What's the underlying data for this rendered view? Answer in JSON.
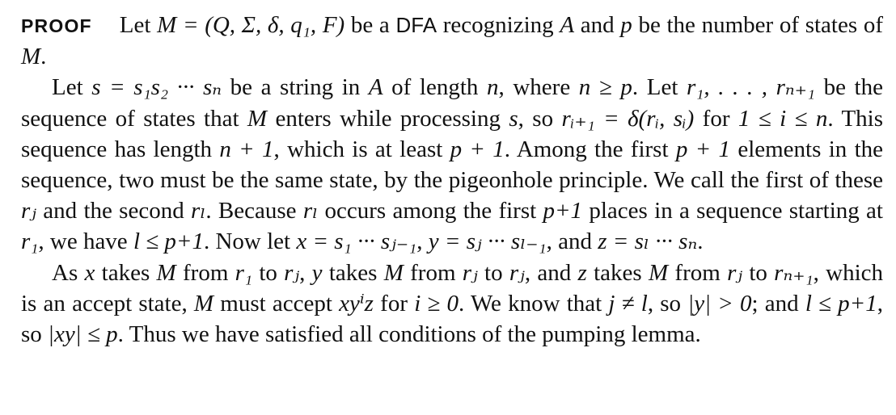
{
  "proof": {
    "label": "PROOF",
    "p1": {
      "t1": "Let ",
      "m1": "M = (Q, Σ, δ, q₁, F)",
      "t2": " be a ",
      "dfa": "DFA",
      "t3": " recognizing ",
      "m2": "A",
      "t4": " and ",
      "m3": "p",
      "t5": " be the number of states of ",
      "m4": "M",
      "t6": "."
    },
    "p2": {
      "t1": "Let ",
      "m1": "s = s₁s₂ ··· sₙ",
      "t2": " be a string in ",
      "m2": "A",
      "t3": " of length ",
      "m3": "n",
      "t4": ", where ",
      "m4": "n ≥ p",
      "t5": ". Let ",
      "m5": "r₁, . . . , rₙ₊₁",
      "t6": " be the sequence of states that ",
      "m6": "M",
      "t7": " enters while processing ",
      "m7": "s",
      "t8": ", so ",
      "m8": "rᵢ₊₁ = δ(rᵢ, sᵢ)",
      "t9": " for ",
      "m9": "1 ≤ i ≤ n",
      "t10": ". This sequence has length ",
      "m10": "n + 1",
      "t11": ", which is at least ",
      "m11": "p + 1",
      "t12": ". Among the first ",
      "m12": "p + 1",
      "t13": " elements in the sequence, two must be the same state, by the pigeonhole principle. We call the first of these ",
      "m13": "rⱼ",
      "t14": " and the second ",
      "m14": "rₗ",
      "t15": ". Because ",
      "m15": "rₗ",
      "t16": " occurs among the first ",
      "m16": "p+1",
      "t17": " places in a sequence starting at ",
      "m17": "r₁",
      "t18": ", we have ",
      "m18": "l ≤ p+1",
      "t19": ". Now let ",
      "m19": "x = s₁ ··· sⱼ₋₁",
      "t20": ", ",
      "m20": "y = sⱼ ··· sₗ₋₁",
      "t21": ", and ",
      "m21": "z = sₗ ··· sₙ",
      "t22": "."
    },
    "p3": {
      "t1": "As ",
      "m1": "x",
      "t2": " takes ",
      "m2": "M",
      "t3": " from ",
      "m3": "r₁",
      "t4": " to ",
      "m4": "rⱼ",
      "t5": ", ",
      "m5": "y",
      "t6": " takes ",
      "m6": "M",
      "t7": " from ",
      "m7": "rⱼ",
      "t8": " to ",
      "m8": "rⱼ",
      "t9": ", and ",
      "m9": "z",
      "t10": " takes ",
      "m10": "M",
      "t11": " from ",
      "m11": "rⱼ",
      "t12": " to ",
      "m12": "rₙ₊₁",
      "t13": ", which is an accept state, ",
      "m13": "M",
      "t14": " must accept ",
      "m14": "xyⁱz",
      "t15": " for ",
      "m15": "i ≥ 0",
      "t16": ". We know that ",
      "m16": "j ≠ l",
      "t17": ", so ",
      "m17": "|y| > 0",
      "t18": "; and ",
      "m18": "l ≤ p+1",
      "t19": ", so ",
      "m19": "|xy| ≤ p",
      "t20": ". Thus we have satisfied all conditions of the pumping lemma."
    }
  }
}
